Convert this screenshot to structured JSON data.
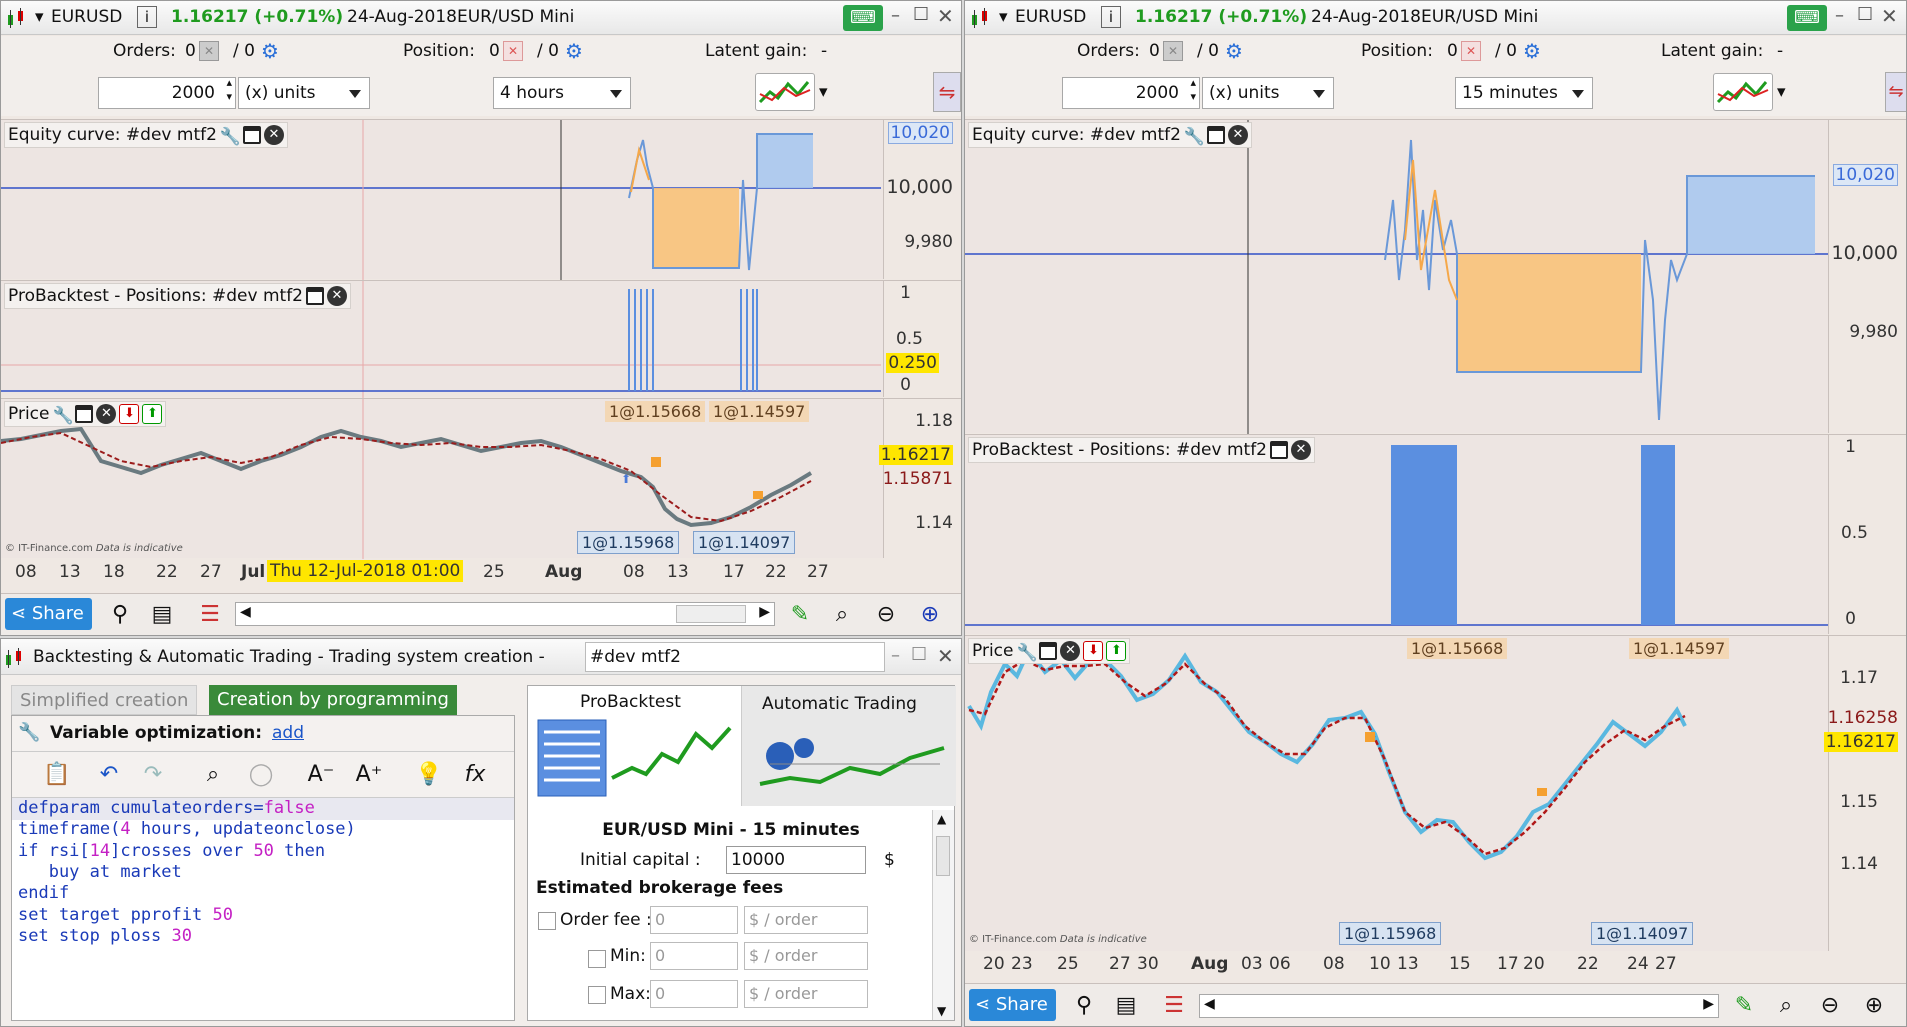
{
  "left": {
    "title": {
      "symbol": "EURUSD",
      "price": "1.16217 (+0.71%)",
      "date": "24-Aug-2018",
      "instrument": "EUR/USD Mini"
    },
    "orders": {
      "label": "Orders:",
      "count": "0",
      "total": "/ 0"
    },
    "position": {
      "label": "Position:",
      "count": "0",
      "total": "/ 0"
    },
    "latent": {
      "label": "Latent gain:",
      "value": "-"
    },
    "qty": "2000",
    "units": "(x) units",
    "timeframe": "4 hours",
    "equity": {
      "title": "Equity curve: #dev mtf2",
      "axis": [
        "10,020",
        "10,000",
        "9,980"
      ]
    },
    "positions": {
      "title": "ProBacktest - Positions: #dev mtf2",
      "axis": [
        "1",
        "0.5",
        "0.250",
        "0"
      ]
    },
    "price": {
      "title": "Price",
      "axis": [
        "1.18",
        "1.16217",
        "1.15871",
        "1.14"
      ],
      "tags": [
        "1@1.15668",
        "1@1.14597",
        "1@1.15968",
        "1@1.14097"
      ],
      "credit": "© IT-Finance.com",
      "credit2": "Data is indicative"
    },
    "xaxis": [
      "08",
      "13",
      "18",
      "22",
      "27",
      "Jul",
      "25",
      "Aug",
      "08",
      "13",
      "17",
      "22",
      "27"
    ],
    "crosshair": "Thu 12-Jul-2018 01:00",
    "share": "Share"
  },
  "right": {
    "title": {
      "symbol": "EURUSD",
      "price": "1.16217 (+0.71%)",
      "date": "24-Aug-2018",
      "instrument": "EUR/USD Mini"
    },
    "orders": {
      "label": "Orders:",
      "count": "0",
      "total": "/ 0"
    },
    "position": {
      "label": "Position:",
      "count": "0",
      "total": "/ 0"
    },
    "latent": {
      "label": "Latent gain:",
      "value": "-"
    },
    "qty": "2000",
    "units": "(x) units",
    "timeframe": "15 minutes",
    "equity": {
      "title": "Equity curve: #dev mtf2",
      "axis": [
        "10,020",
        "10,000",
        "9,980"
      ]
    },
    "positions": {
      "title": "ProBacktest - Positions: #dev mtf2",
      "axis": [
        "1",
        "0.5",
        "0"
      ]
    },
    "price": {
      "title": "Price",
      "axis": [
        "1.17",
        "1.16258",
        "1.16217",
        "1.15",
        "1.14"
      ],
      "tags": [
        "1@1.15668",
        "1@1.14597",
        "1@1.15968",
        "1@1.14097"
      ],
      "credit": "© IT-Finance.com",
      "credit2": "Data is indicative"
    },
    "xaxis": [
      "20",
      "23",
      "25",
      "27",
      "30",
      "Aug",
      "03",
      "06",
      "08",
      "10",
      "13",
      "15",
      "17",
      "20",
      "22",
      "24",
      "27"
    ],
    "share": "Share"
  },
  "creator": {
    "title": "Backtesting & Automatic Trading - Trading system creation -",
    "name": "#dev mtf2",
    "tabs": [
      "Simplified creation",
      "Creation by programming"
    ],
    "varopt": "Variable optimization:",
    "add": "add",
    "code": [
      "defparam cumulateorders=false",
      "timeframe(4 hours, updateonclose)",
      "if rsi[14]crosses over 50 then",
      "   buy at market",
      "endif",
      "set target pprofit 50",
      "set stop ploss 30"
    ],
    "probacktest": "ProBacktest",
    "autotrading": "Automatic Trading",
    "instrument": "EUR/USD Mini - 15 minutes",
    "capital_label": "Initial capital :",
    "capital": "10000",
    "currency": "$",
    "fees": "Estimated brokerage fees",
    "orderfee": "Order fee :",
    "min": "Min:",
    "max": "Max:",
    "zero": "0",
    "perorder": "$ / order"
  },
  "colors": {
    "accent_blue": "#4a86e8",
    "equity_orange": "#f5a84a",
    "price_green": "#1f9b1f",
    "highlight_yellow": "#ffe600",
    "share_blue": "#2a88d8"
  }
}
